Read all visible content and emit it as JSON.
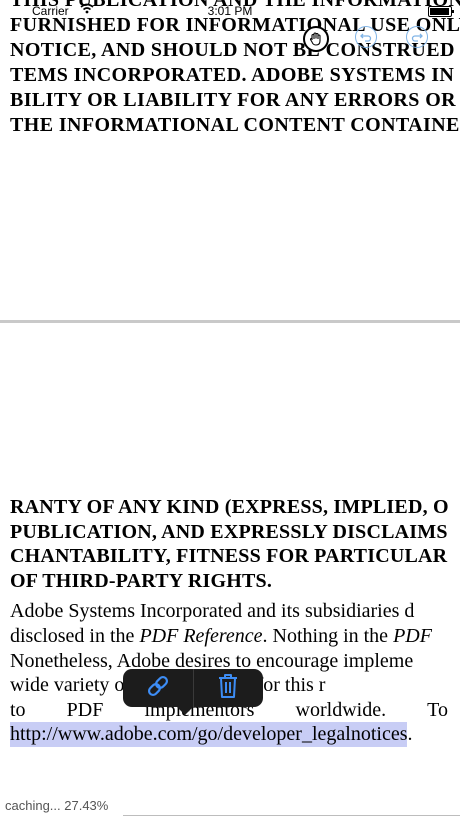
{
  "status_bar": {
    "carrier": "Carrier",
    "time": "3:01 PM"
  },
  "toolbar": {
    "hand": "hand-tool",
    "undo": "undo",
    "redo": "redo"
  },
  "page1_lines": [
    "THIS PUBLICATION AND THE INFORMATION",
    "FURNISHED FOR INFORMATIONAL USE ONLY",
    "NOTICE, AND SHOULD NOT BE CONSTRUED",
    "TEMS INCORPORATED. ADOBE SYSTEMS IN",
    "BILITY OR LIABILITY FOR ANY ERRORS OR",
    "THE INFORMATIONAL CONTENT CONTAINED"
  ],
  "page2": {
    "bold_lines": [
      "RANTY OF ANY KIND (EXPRESS, IMPLIED, O",
      "PUBLICATION, AND EXPRESSLY DISCLAIMS",
      "CHANTABILITY, FITNESS FOR PARTICULAR",
      "OF THIRD-PARTY RIGHTS."
    ],
    "line1": "Adobe Systems Incorporated and its subsidiaries d",
    "line2_a": "disclosed in the ",
    "line2_em1": "PDF Reference",
    "line2_b": ". Nothing in the ",
    "line2_em2": "PDF",
    "line3": "Nonetheless, Adobe desires to encourage impleme",
    "line4": "wide variety of platforms, and for this r",
    "line5_words": [
      "to",
      "PDF",
      "implementors",
      "worldwide.",
      "To"
    ],
    "url": "http://www.adobe.com/go/developer_legalnotices",
    "url_after": "."
  },
  "popup": {
    "link_icon": "link-icon",
    "trash_icon": "trash-icon"
  },
  "caching": {
    "label": "caching... 27.43%",
    "progress": 0.2743
  }
}
